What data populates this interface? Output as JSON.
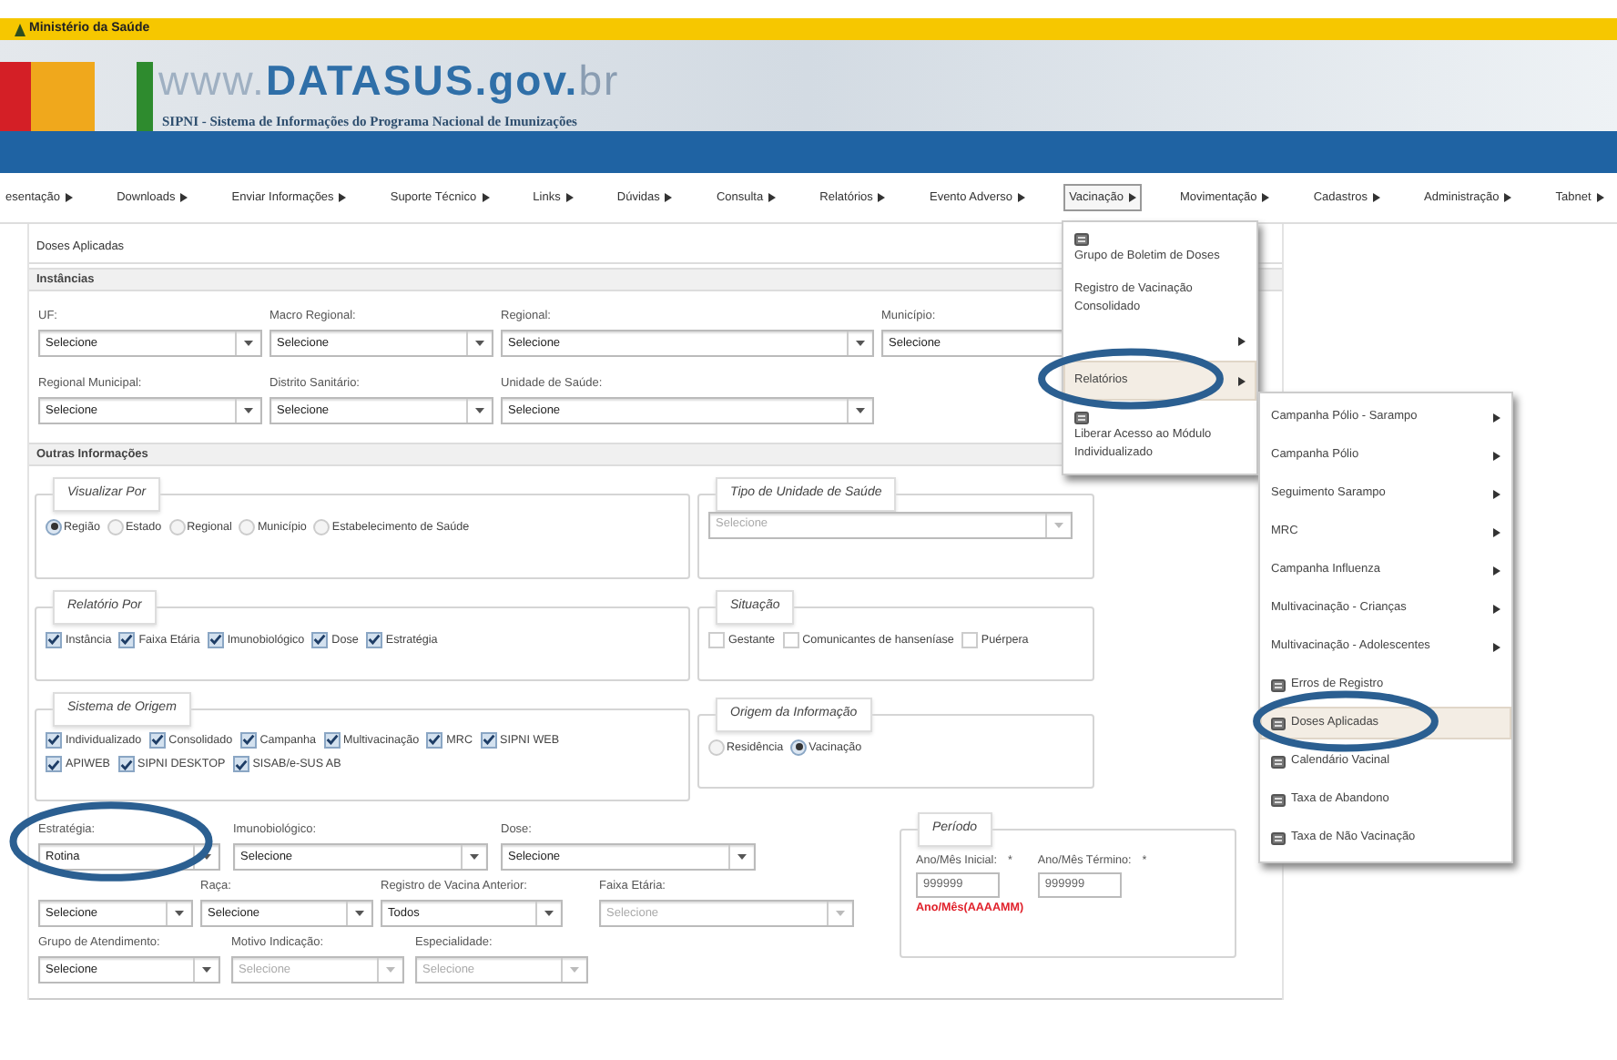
{
  "header": {
    "ministry": "Ministério da Saúde",
    "logo_parts": [
      "www.",
      "DATASUS",
      ".gov.",
      "br"
    ],
    "subtitle": "SIPNI - Sistema de Informações do Programa Nacional de Imunizações"
  },
  "menu": [
    {
      "label": "esentação",
      "selected": false
    },
    {
      "label": "Downloads",
      "selected": false
    },
    {
      "label": "Enviar Informações",
      "selected": false
    },
    {
      "label": "Suporte Técnico",
      "selected": false
    },
    {
      "label": "Links",
      "selected": false
    },
    {
      "label": "Dúvidas",
      "selected": false
    },
    {
      "label": "Consulta",
      "selected": false
    },
    {
      "label": "Relatórios",
      "selected": false
    },
    {
      "label": "Evento Adverso",
      "selected": false
    },
    {
      "label": "Vacinação",
      "selected": true
    },
    {
      "label": "Movimentação",
      "selected": false
    },
    {
      "label": "Cadastros",
      "selected": false
    },
    {
      "label": "Administração",
      "selected": false
    },
    {
      "label": "Tabnet",
      "selected": false
    }
  ],
  "dropdown": {
    "items": [
      {
        "label": "Grupo de Boletim de Doses",
        "icon": true,
        "submenu": false,
        "selected": false,
        "circled": false
      },
      {
        "label": "Registro de Vacinação Consolidado",
        "icon": false,
        "submenu": false,
        "selected": false,
        "circled": false
      },
      {
        "icon": false,
        "submenu": true,
        "selected": false,
        "circled": false
      },
      {
        "label": "Relatórios",
        "icon": false,
        "submenu": true,
        "selected": true,
        "circled": true
      },
      {
        "label": "Liberar Acesso ao Módulo Individualizado",
        "icon": true,
        "submenu": false,
        "selected": false,
        "circled": false
      }
    ]
  },
  "submenu": {
    "items": [
      {
        "label": "Campanha Pólio - Sarampo",
        "icon": false,
        "submenu": true,
        "selected": false,
        "circled": false
      },
      {
        "label": "Campanha Pólio",
        "icon": false,
        "submenu": true,
        "selected": false,
        "circled": false
      },
      {
        "label": "Seguimento Sarampo",
        "icon": false,
        "submenu": true,
        "selected": false,
        "circled": false
      },
      {
        "label": "MRC",
        "icon": false,
        "submenu": true,
        "selected": false,
        "circled": false
      },
      {
        "label": "Campanha Influenza",
        "icon": false,
        "submenu": true,
        "selected": false,
        "circled": false
      },
      {
        "label": "Multivacinação - Crianças",
        "icon": false,
        "submenu": true,
        "selected": false,
        "circled": false
      },
      {
        "label": "Multivacinação - Adolescentes",
        "icon": false,
        "submenu": true,
        "selected": false,
        "circled": false
      },
      {
        "label": "Erros de Registro",
        "icon": true,
        "submenu": false,
        "selected": false,
        "circled": false
      },
      {
        "label": "Doses Aplicadas",
        "icon": true,
        "submenu": false,
        "selected": true,
        "circled": true
      },
      {
        "label": "Calendário Vacinal",
        "icon": true,
        "submenu": false,
        "selected": false,
        "circled": false
      },
      {
        "label": "Taxa de Abandono",
        "icon": true,
        "submenu": false,
        "selected": false,
        "circled": false
      },
      {
        "label": "Taxa de Não Vacinação",
        "icon": true,
        "submenu": false,
        "selected": false,
        "circled": false
      }
    ]
  },
  "page_title": "Doses Aplicadas",
  "instancias": {
    "title": "Instâncias",
    "rows": [
      [
        {
          "label": "UF:",
          "value": "Selecione",
          "disabled": false,
          "circled": false
        },
        {
          "label": "Macro Regional:",
          "value": "Selecione",
          "disabled": false,
          "circled": false
        },
        {
          "label": "Regional:",
          "value": "Selecione",
          "disabled": false,
          "circled": false
        },
        {
          "label": "Município:",
          "value": "Selecione",
          "disabled": false,
          "circled": false
        }
      ],
      [
        {
          "label": "Regional Municipal:",
          "value": "Selecione",
          "disabled": false,
          "circled": false
        },
        {
          "label": "Distrito Sanitário:",
          "value": "Selecione",
          "disabled": false,
          "circled": false
        },
        {
          "label": "Unidade de Saúde:",
          "value": "Selecione",
          "disabled": false,
          "circled": false
        }
      ]
    ]
  },
  "outras": {
    "title": "Outras Informações",
    "visualizar_por": {
      "legend": "Visualizar Por",
      "options": [
        {
          "label": "Região",
          "selected": true
        },
        {
          "label": "Estado",
          "selected": false
        },
        {
          "label": "Regional",
          "selected": false
        },
        {
          "label": "Município",
          "selected": false
        },
        {
          "label": "Estabelecimento de Saúde",
          "selected": false
        }
      ]
    },
    "tipo_unidade": {
      "legend": "Tipo de Unidade de Saúde",
      "value": "Selecione",
      "disabled": true
    },
    "relatorio_por": {
      "legend": "Relatório Por",
      "options": [
        {
          "label": "Instância",
          "checked": true
        },
        {
          "label": "Faixa Etária",
          "checked": true
        },
        {
          "label": "Imunobiológico",
          "checked": true
        },
        {
          "label": "Dose",
          "checked": true
        },
        {
          "label": "Estratégia",
          "checked": true
        }
      ]
    },
    "situacao": {
      "legend": "Situação",
      "options": [
        {
          "label": "Gestante",
          "checked": false
        },
        {
          "label": "Comunicantes de hanseníase",
          "checked": false
        },
        {
          "label": "Puérpera",
          "checked": false
        }
      ]
    },
    "sistema_origem": {
      "legend": "Sistema de Origem",
      "options": [
        {
          "label": "Individualizado",
          "checked": true
        },
        {
          "label": "Consolidado",
          "checked": true
        },
        {
          "label": "Campanha",
          "checked": true
        },
        {
          "label": "Multivacinação",
          "checked": true
        },
        {
          "label": "MRC",
          "checked": true
        },
        {
          "label": "SIPNI WEB",
          "checked": true
        },
        {
          "label": "APIWEB",
          "checked": true
        },
        {
          "label": "SIPNI DESKTOP",
          "checked": true
        },
        {
          "label": "SISAB/e-SUS AB",
          "checked": true
        }
      ]
    },
    "origem_informacao": {
      "legend": "Origem da Informação",
      "options": [
        {
          "label": "Residência",
          "selected": false
        },
        {
          "label": "Vacinação",
          "selected": true
        }
      ]
    }
  },
  "filters": [
    [
      {
        "label": "Estratégia:",
        "value": "Rotina",
        "disabled": false,
        "circled": true
      },
      {
        "label": "Imunobiológico:",
        "value": "Selecione",
        "disabled": false,
        "circled": false
      },
      {
        "label": "Dose:",
        "value": "Selecione",
        "disabled": false,
        "circled": false
      }
    ],
    [
      {
        "value": "Selecione",
        "disabled": false,
        "circled": false
      },
      {
        "label": "Raça:",
        "value": "Selecione",
        "disabled": false,
        "circled": false
      },
      {
        "label": "Registro de Vacina Anterior:",
        "value": "Todos",
        "disabled": false,
        "circled": false
      },
      {
        "label": "Faixa Etária:",
        "value": "Selecione",
        "disabled": true,
        "circled": false
      }
    ],
    [
      {
        "label": "Grupo de Atendimento:",
        "value": "Selecione",
        "disabled": false,
        "circled": false
      },
      {
        "label": "Motivo Indicação:",
        "value": "Selecione",
        "disabled": true,
        "circled": false
      },
      {
        "label": "Especialidade:",
        "value": "Selecione",
        "disabled": true,
        "circled": false
      }
    ]
  ],
  "periodo": {
    "legend": "Período",
    "fields": [
      {
        "label": "Ano/Mês Inicial:",
        "required_mark": "*",
        "placeholder": "999999"
      },
      {
        "label": "Ano/Mês Término:",
        "required_mark": "*",
        "placeholder": "999999"
      }
    ],
    "hint": "Ano/Mês(AAAAMM)"
  }
}
